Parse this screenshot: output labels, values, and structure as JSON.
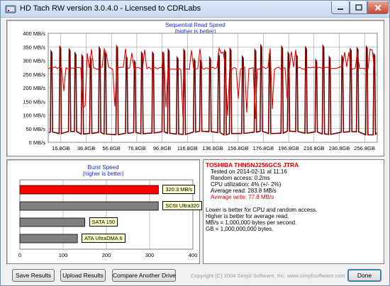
{
  "window": {
    "title": "HD Tach RW version 3.0.4.0 - Licensed to CDRLabs"
  },
  "sequential_chart": {
    "title": "Sequential Read Speed",
    "subtitle": "(higher is better)",
    "y_ticks": [
      "400 MB/s",
      "350 MB/s",
      "300 MB/s",
      "250 MB/s",
      "200 MB/s",
      "150 MB/s",
      "100 MB/s",
      "50 MB/s",
      "0 MB/s"
    ],
    "x_ticks": [
      "16.8GB",
      "36.8GB",
      "56.8GB",
      "76.8GB",
      "96.8GB",
      "116.8GB",
      "136.8GB",
      "156.8GB",
      "176.8GB",
      "196.8GB",
      "216.8GB",
      "236.8GB",
      "256.8GB"
    ]
  },
  "burst_chart": {
    "title": "Burst Speed",
    "subtitle": "(higher is better)",
    "x_ticks": [
      "0",
      "100",
      "200",
      "300",
      "400"
    ]
  },
  "drive_info": {
    "name": "TOSHIBA THNSNJ256GCS JTRA",
    "tested_on": "Tested on 2014-02-11 at 11:16",
    "random_access": "Random access: 0.2ms",
    "cpu_utilization": "CPU utilization: 4% (+/- 2%)",
    "average_read": "Average read: 283.8 MB/s",
    "average_write": "Average write: 77.8 MB/s",
    "notes": [
      "Lower is better for CPU and random access.",
      "Higher is better for average read.",
      "MB/s = 1,000,000 bytes per second.",
      "GB = 1,000,000,000 bytes."
    ]
  },
  "buttons": {
    "save": "Save Results",
    "upload": "Upload Results",
    "compare": "Compare Another Drive",
    "done": "Done"
  },
  "copyright": "Copyright (C) 2004 Simpli Software, Inc. www.simplisoftware.com",
  "chart_data": [
    {
      "type": "line",
      "title": "Sequential Read Speed",
      "subtitle": "(higher is better)",
      "ylim": [
        0,
        400
      ],
      "y_unit": "MB/s",
      "x_ticks": [
        "16.8GB",
        "36.8GB",
        "56.8GB",
        "76.8GB",
        "96.8GB",
        "116.8GB",
        "136.8GB",
        "156.8GB",
        "176.8GB",
        "196.8GB",
        "216.8GB",
        "236.8GB",
        "256.8GB"
      ],
      "series": [
        {
          "color": "#e00000",
          "baseline": 272,
          "peak": 345
        },
        {
          "color": "#7a0000",
          "baseline": 35,
          "peak": 355
        }
      ],
      "grid": true
    },
    {
      "type": "bar",
      "orientation": "horizontal",
      "title": "Burst Speed",
      "subtitle": "(higher is better)",
      "xlim": [
        0,
        400
      ],
      "bars": [
        {
          "label": "320.3 MB/s",
          "value": 320.3,
          "color": "#ff0000"
        },
        {
          "label": "SCSI Ultra320",
          "value": 320,
          "color": "#808080"
        },
        {
          "label": "SATA 150",
          "value": 150,
          "color": "#808080"
        },
        {
          "label": "ATA UltraDMA 6",
          "value": 133,
          "color": "#808080"
        }
      ]
    }
  ]
}
